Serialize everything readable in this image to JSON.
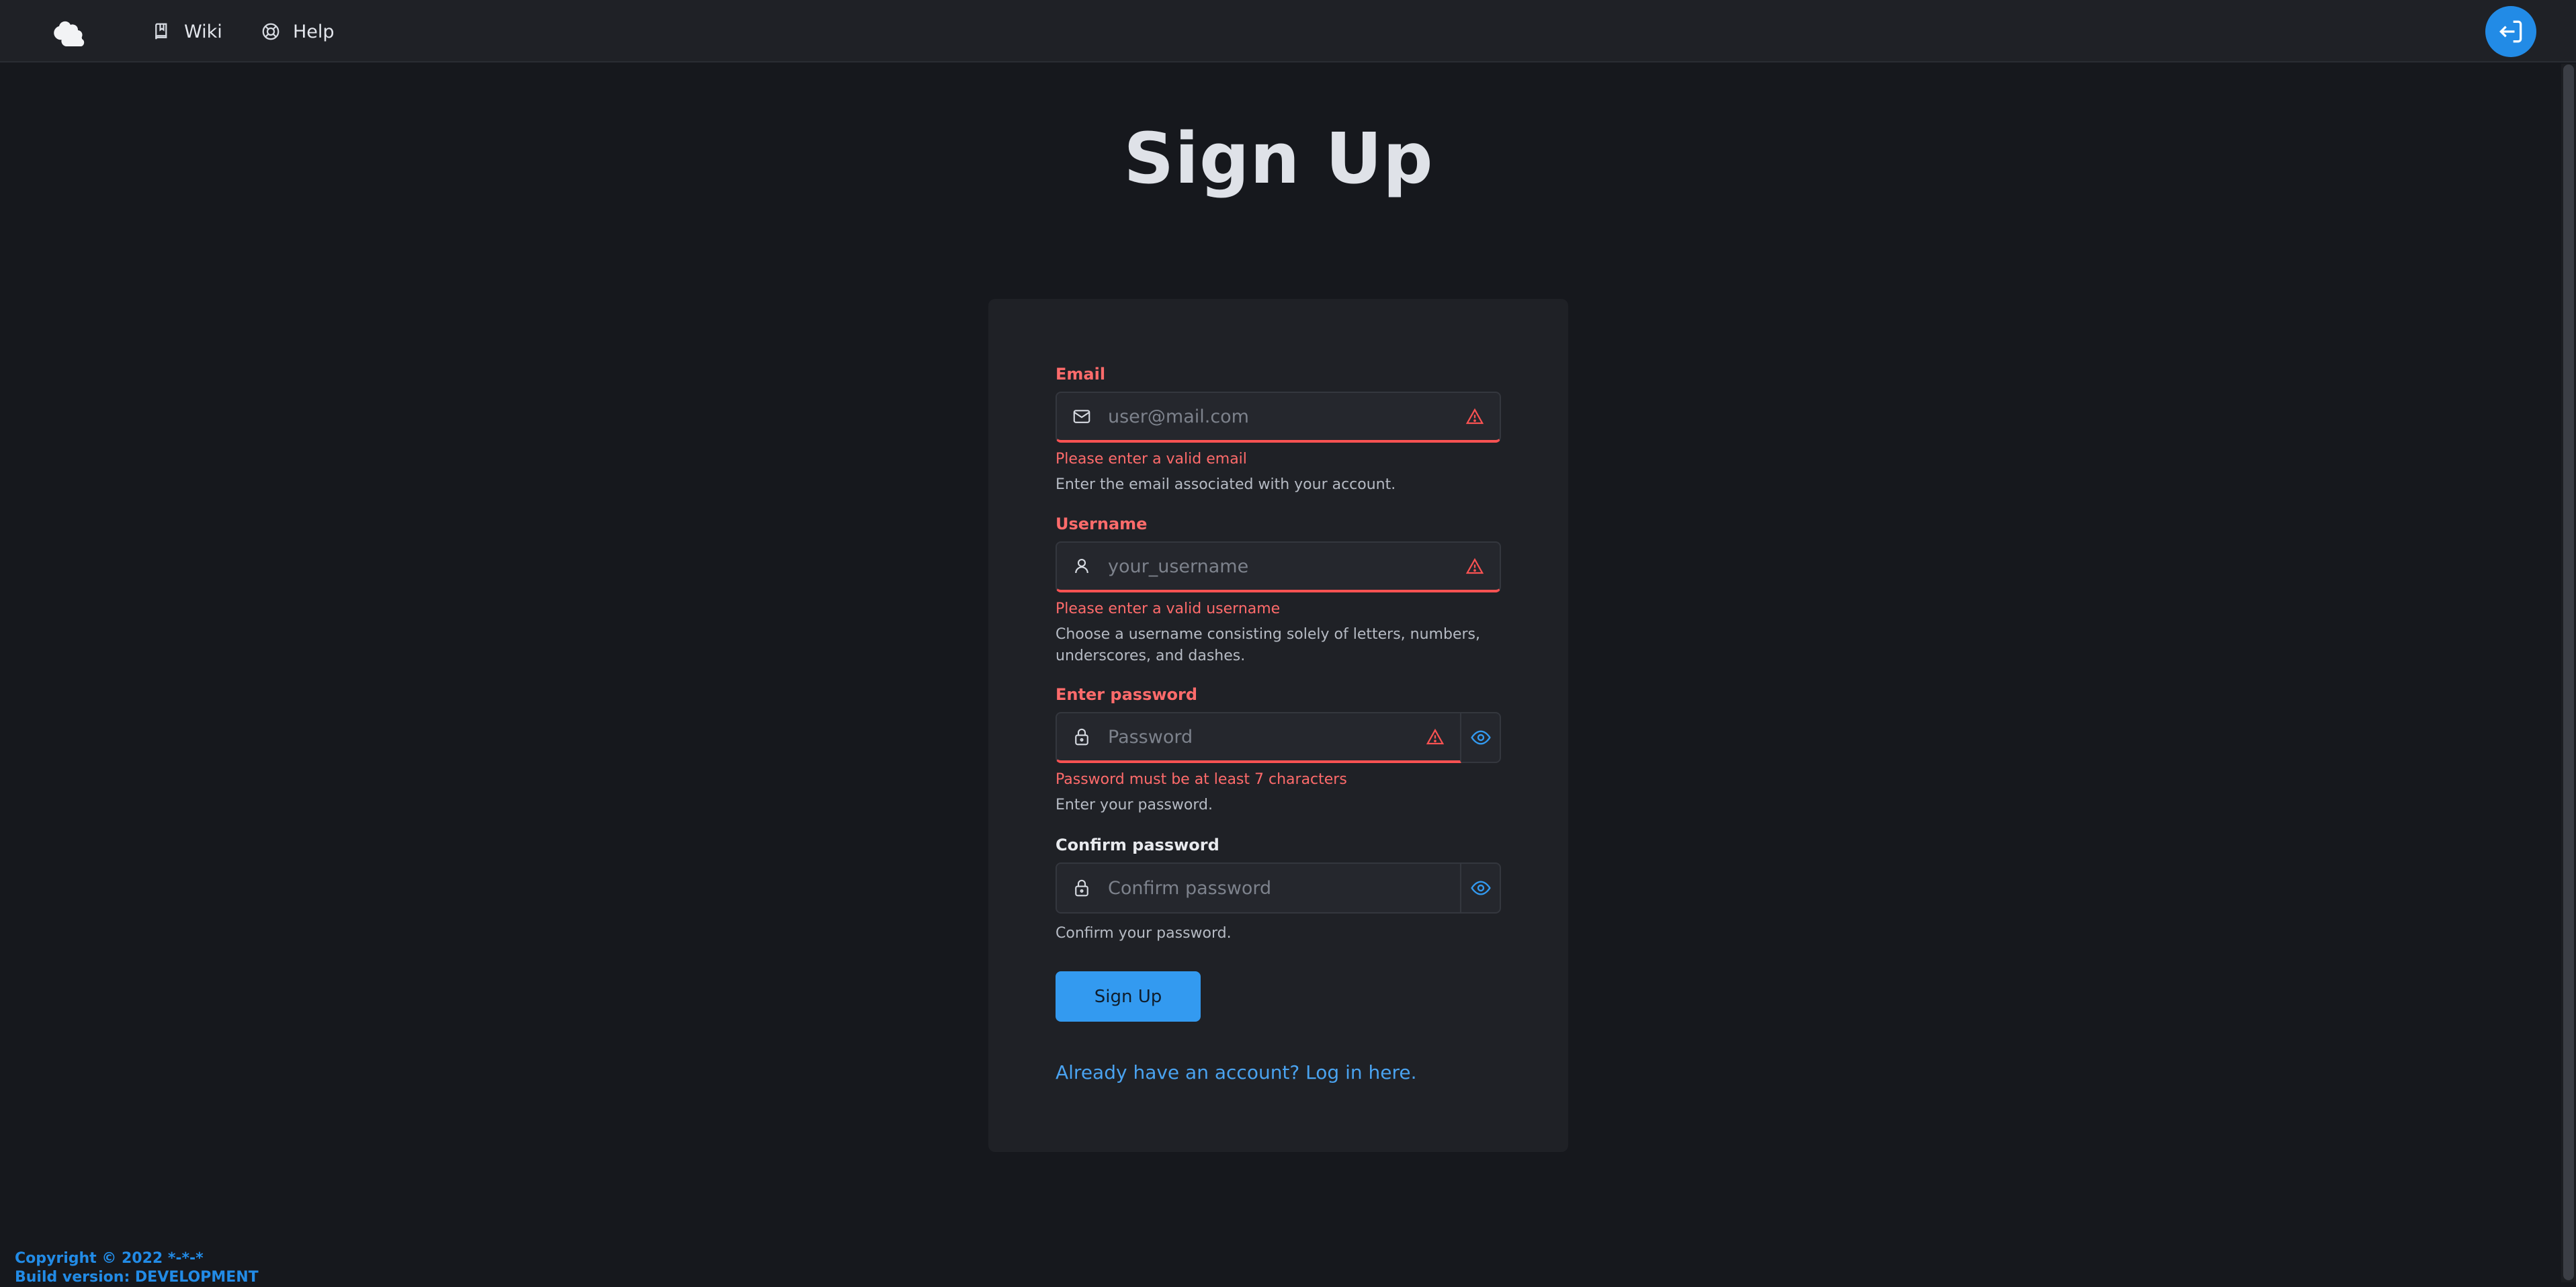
{
  "nav": {
    "wiki_label": "Wiki",
    "help_label": "Help"
  },
  "page": {
    "title": "Sign Up"
  },
  "form": {
    "email": {
      "label": "Email",
      "placeholder": "user@mail.com",
      "error": "Please enter a valid email",
      "description": "Enter the email associated with your account."
    },
    "username": {
      "label": "Username",
      "placeholder": "your_username",
      "error": "Please enter a valid username",
      "description": "Choose a username consisting solely of letters, numbers, underscores, and dashes."
    },
    "password": {
      "label": "Enter password",
      "placeholder": "Password",
      "error": "Password must be at least 7 characters",
      "description": "Enter your password."
    },
    "confirm_password": {
      "label": "Confirm password",
      "placeholder": "Confirm password",
      "description": "Confirm your password."
    },
    "submit_label": "Sign Up",
    "login_link": "Already have an account? Log in here."
  },
  "footer": {
    "copyright": "Copyright © 2022 *-*-*",
    "build": "Build version: DEVELOPMENT"
  },
  "colors": {
    "accent": "#339af0",
    "error": "#fa5252",
    "background": "#16181d",
    "card": "#1f2126"
  }
}
